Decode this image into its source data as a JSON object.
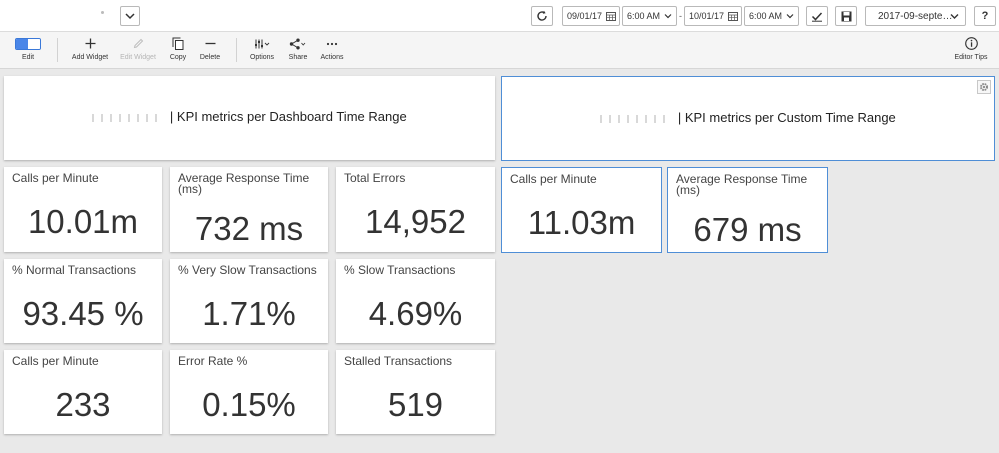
{
  "topbar": {
    "start_date": "09/01/17",
    "start_time": "6:00 AM",
    "end_date": "10/01/17",
    "end_time": "6:00 AM",
    "range_dash": "-",
    "dashboard_name": "2017-09-septe…",
    "help_label": "?"
  },
  "toolbar": {
    "edit": "Edit",
    "add_widget": "Add Widget",
    "edit_widget": "Edit Widget",
    "copy": "Copy",
    "delete": "Delete",
    "options": "Options",
    "share": "Share",
    "actions": "Actions",
    "editor_tips": "Editor Tips"
  },
  "headers": {
    "left": "| KPI metrics per Dashboard Time Range",
    "right": "| KPI metrics per Custom Time Range"
  },
  "kpis": [
    {
      "label": "Calls per Minute",
      "value": "10.01m"
    },
    {
      "label": "Average Response Time (ms)",
      "value": "732 ms"
    },
    {
      "label": "Total Errors",
      "value": "14,952"
    },
    {
      "label": "Calls per Minute",
      "value": "11.03m"
    },
    {
      "label": "Average Response Time (ms)",
      "value": "679 ms"
    },
    {
      "label": "% Normal Transactions",
      "value": "93.45 %"
    },
    {
      "label": "% Very Slow Transactions",
      "value": "1.71%"
    },
    {
      "label": "% Slow Transactions",
      "value": "4.69%"
    },
    {
      "label": "Calls per Minute",
      "value": "233"
    },
    {
      "label": "Error Rate %",
      "value": "0.15%"
    },
    {
      "label": "Stalled Transactions",
      "value": "519"
    }
  ],
  "colors": {
    "accent": "#4a86e8",
    "selected_border": "#4f8ed6",
    "canvas": "#e9e9e9"
  },
  "icons": [
    "chevron-down-icon",
    "refresh-icon",
    "calendar-icon",
    "checkmark-icon",
    "save-icon",
    "plus-icon",
    "pencil-icon",
    "copy-icon",
    "minus-icon",
    "sliders-icon",
    "share-icon",
    "ellipsis-icon",
    "info-icon",
    "gear-icon"
  ]
}
